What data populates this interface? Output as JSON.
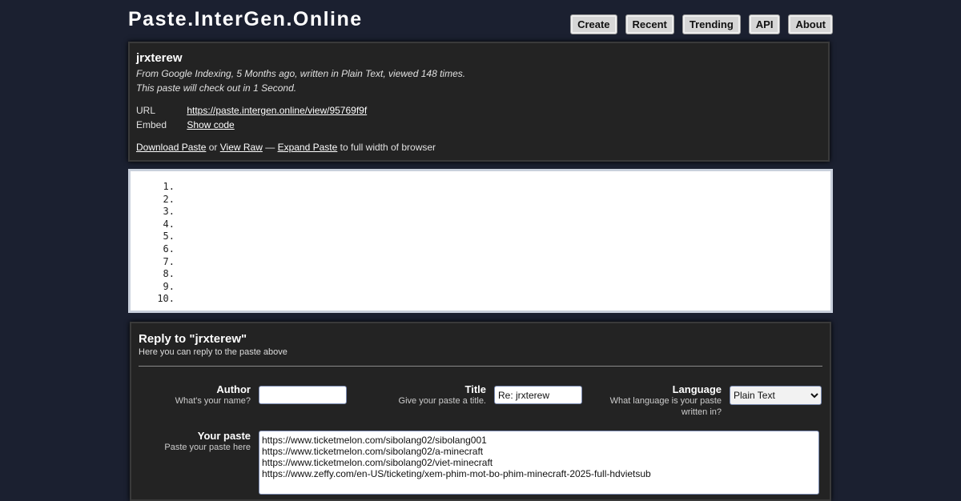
{
  "site": {
    "logo": "Paste.InterGen.Online"
  },
  "nav": [
    "Create",
    "Recent",
    "Trending",
    "API",
    "About"
  ],
  "paste": {
    "title": "jrxterew",
    "meta": "From Google Indexing, 5 Months ago, written in Plain Text, viewed 148 times.",
    "expiry": "This paste will check out in 1 Second.",
    "url_label": "URL",
    "url": "https://paste.intergen.online/view/95769f9f",
    "embed_label": "Embed",
    "embed_link": "Show code",
    "download": "Download Paste",
    "or": "or",
    "view_raw": "View Raw",
    "dash": "—",
    "expand": "Expand Paste",
    "expand_suffix": "to full width of browser"
  },
  "code_lines": [
    "1.",
    "2.",
    "3.",
    "4.",
    "5.",
    "6.",
    "7.",
    "8.",
    "9.",
    "10."
  ],
  "reply": {
    "title": "Reply to \"jrxterew\"",
    "subtitle": "Here you can reply to the paste above",
    "author_label": "Author",
    "author_hint": "What's your name?",
    "author_value": "",
    "title_label": "Title",
    "title_hint": "Give your paste a title.",
    "title_value": "Re: jrxterew",
    "language_label": "Language",
    "language_hint": "What language is your paste written in?",
    "language_value": "Plain Text",
    "paste_label": "Your paste",
    "paste_hint": "Paste your paste here",
    "paste_lines": [
      "https://www.ticketmelon.com/sibolang02/sibolang001",
      "https://www.ticketmelon.com/sibolang02/a-minecraft",
      "https://www.ticketmelon.com/sibolang02/viet-minecraft",
      "https://www.zeffy.com/en-US/ticketing/xem-phim-mot-bo-phim-minecraft-2025-full-hdvietsub"
    ]
  }
}
